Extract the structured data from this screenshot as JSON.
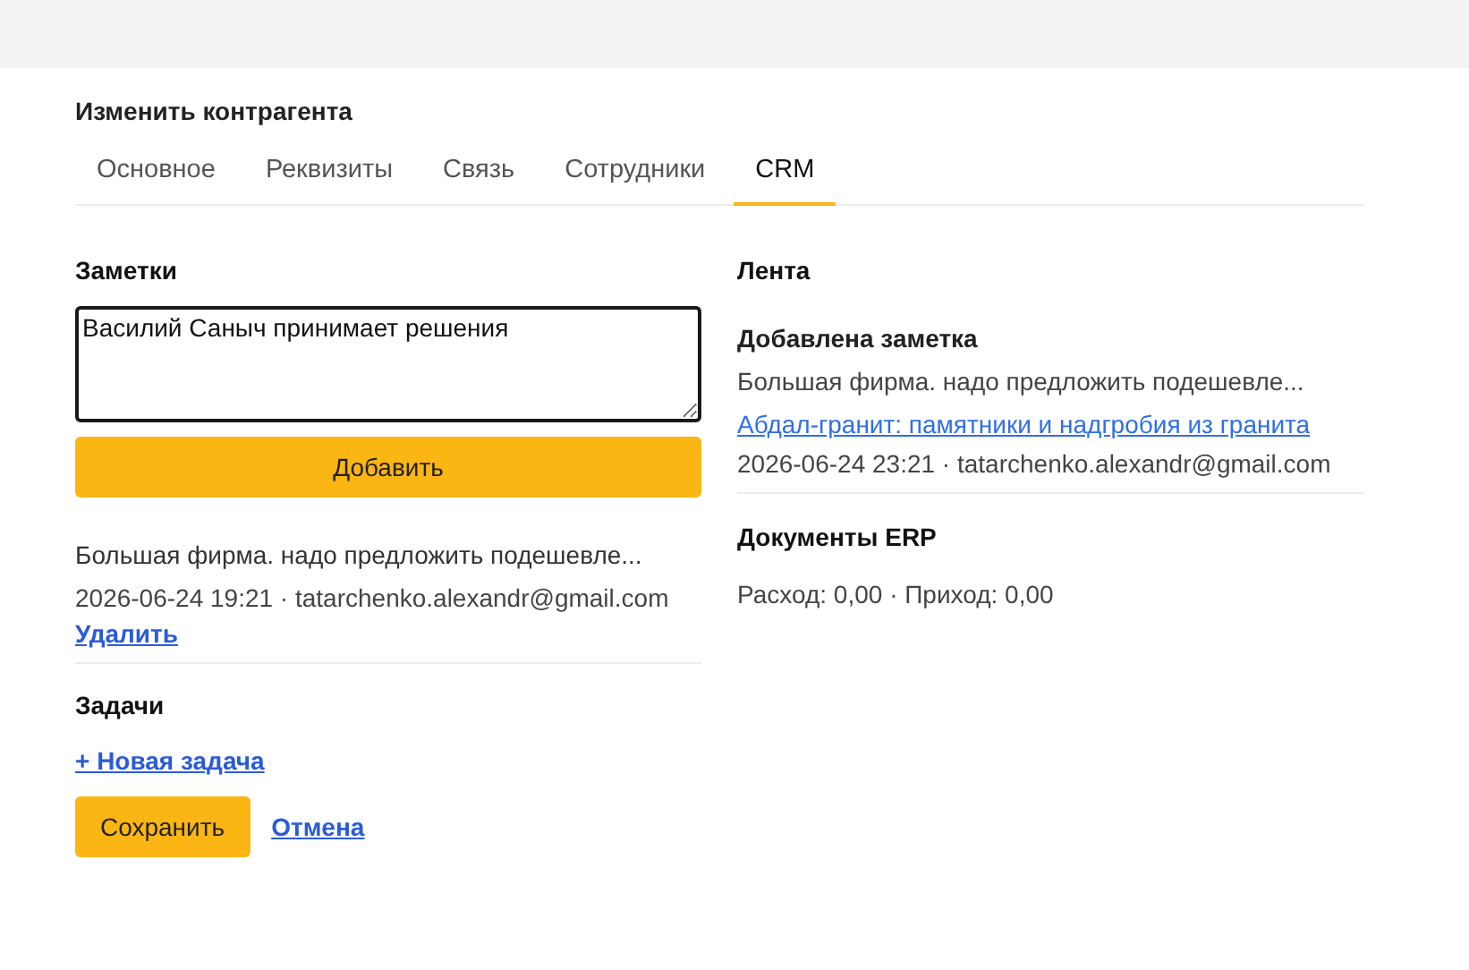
{
  "dialog": {
    "title": "Изменить контрагента"
  },
  "tabs": [
    {
      "label": "Основное",
      "selected": false
    },
    {
      "label": "Реквизиты",
      "selected": false
    },
    {
      "label": "Связь",
      "selected": false
    },
    {
      "label": "Сотрудники",
      "selected": false
    },
    {
      "label": "CRM",
      "selected": true
    }
  ],
  "notes": {
    "heading": "Заметки",
    "value": "Василий Саныч принимает решения",
    "add_button": "Добавить",
    "items": [
      {
        "text": "Большая фирма. надо предложить подешевле...",
        "meta": "2026-06-24 19:21 · tatarchenko.alexandr@gmail.com",
        "delete_link": "Удалить"
      }
    ]
  },
  "tasks": {
    "heading": "Задачи",
    "new_task_link": "+ Новая задача"
  },
  "actions": {
    "save_button": "Сохранить",
    "cancel_link": "Отмена"
  },
  "feed": {
    "heading": "Лента",
    "items": [
      {
        "title": "Добавлена заметка",
        "text": "Большая фирма. надо предложить подешевле...",
        "link": "Абдал-гранит: памятники и надгробия из гранита",
        "meta": "2026-06-24 23:21 · tatarchenko.alexandr@gmail.com"
      }
    ]
  },
  "erp": {
    "heading": "Документы ERP",
    "summary": "Расход: 0,00 · Приход: 0,00"
  }
}
